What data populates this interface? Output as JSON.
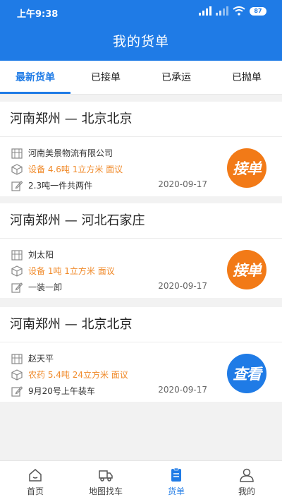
{
  "status_bar": {
    "time": "上午9:38",
    "battery": "87"
  },
  "header": {
    "title": "我的货单"
  },
  "tabs": [
    {
      "label": "最新货单",
      "active": true
    },
    {
      "label": "已接单",
      "active": false
    },
    {
      "label": "已承运",
      "active": false
    },
    {
      "label": "已抛单",
      "active": false
    }
  ],
  "orders": [
    {
      "route": "河南郑州 — 北京北京",
      "shipper": "河南美景物流有限公司",
      "cargo": "设备 4.6吨 1立方米 面议",
      "note": "2.3吨一件共两件",
      "date": "2020-09-17",
      "action": "接单"
    },
    {
      "route": "河南郑州 — 河北石家庄",
      "shipper": "刘太阳",
      "cargo": "设备 1吨 1立方米 面议",
      "note": "一装一卸",
      "date": "2020-09-17",
      "action": "接单"
    },
    {
      "route": "河南郑州 — 北京北京",
      "shipper": "赵天平",
      "cargo": "农药 5.4吨 24立方米 面议",
      "note": "9月20号上午装车",
      "date": "2020-09-17",
      "action": "查看"
    }
  ],
  "bottom_nav": [
    {
      "label": "首页",
      "icon": "home-icon",
      "active": false
    },
    {
      "label": "地图找车",
      "icon": "truck-icon",
      "active": false
    },
    {
      "label": "货单",
      "icon": "document-icon",
      "active": true
    },
    {
      "label": "我的",
      "icon": "user-icon",
      "active": false
    }
  ],
  "colors": {
    "primary": "#1f7be6",
    "accent": "#f27a17"
  }
}
